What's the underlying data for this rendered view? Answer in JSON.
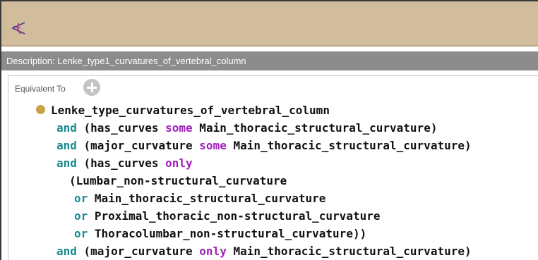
{
  "toolbar": {
    "logo_icon": "protege-logo-icon",
    "background": "#d1bc9c"
  },
  "description_bar": {
    "label": "Description: Lenke_type1_curvatures_of_vertebral_column"
  },
  "section": {
    "equivalent_label": "Equivalent To",
    "add_icon": "plus-circle-icon"
  },
  "expression": {
    "class_name": "Lenke_type_curvatures_of_vertebral_column",
    "bullet_color": "#c9a24a",
    "keyword_colors": {
      "and_or": "#1a8a8e",
      "some_only": "#a020b8"
    },
    "lines": [
      {
        "kw1": "and",
        "pre": " (has_curves ",
        "kw2": "some",
        "post": " Main_thoracic_structural_curvature)"
      },
      {
        "kw1": "and",
        "pre": " (major_curvature ",
        "kw2": "some",
        "post": " Main_thoracic_structural_curvature)"
      },
      {
        "kw1": "and",
        "pre": " (has_curves ",
        "kw2": "only",
        "post": ""
      },
      {
        "text": "(Lumbar_non-structural_curvature"
      },
      {
        "kw1": "or",
        "post": " Main_thoracic_structural_curvature"
      },
      {
        "kw1": "or",
        "post": " Proximal_thoracic_non-structural_curvature"
      },
      {
        "kw1": "or",
        "post": " Thoracolumbar_non-structural_curvature))"
      },
      {
        "kw1": "and",
        "pre": " (major_curvature ",
        "kw2": "only",
        "post": " Main_thoracic_structural_curvature)"
      }
    ]
  }
}
